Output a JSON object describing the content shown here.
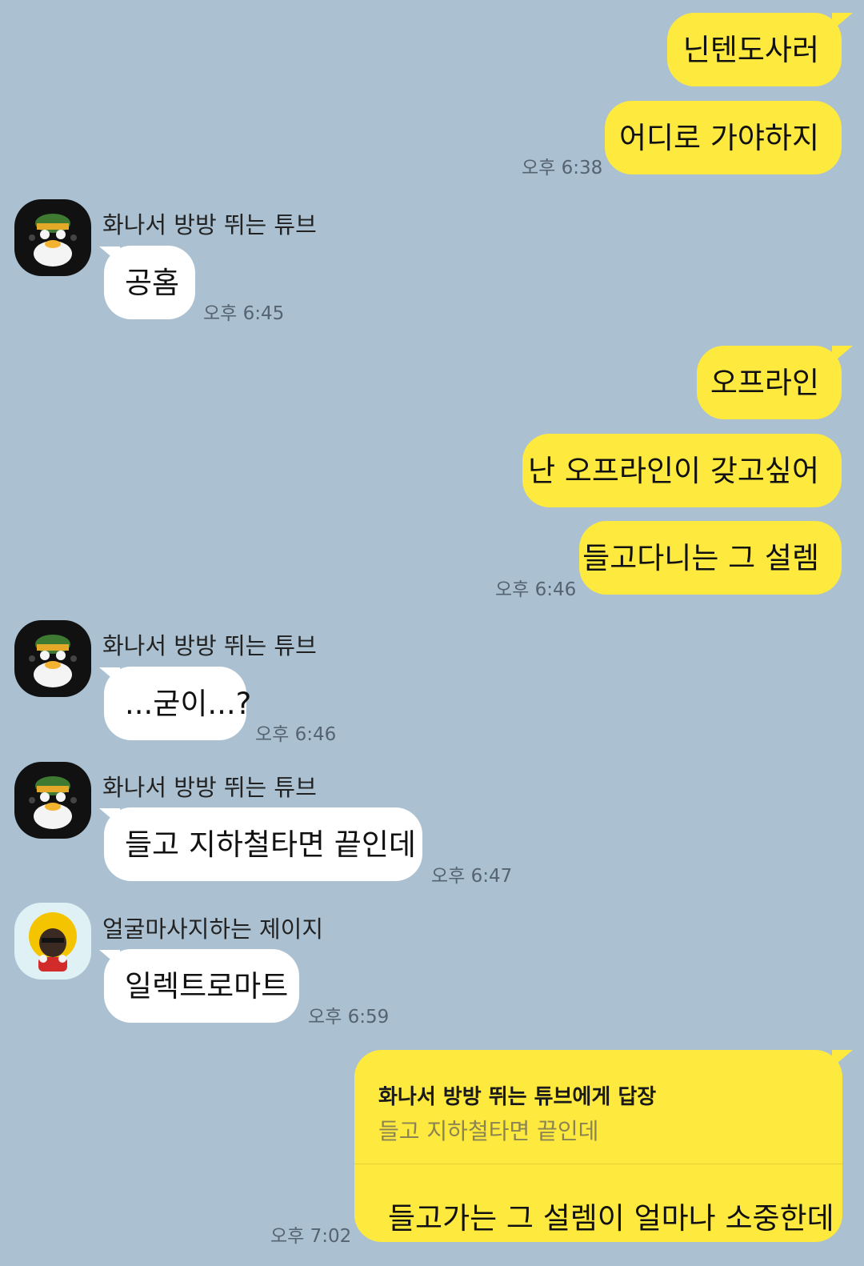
{
  "colors": {
    "background": "#abc1d1",
    "my_bubble": "#fee93e",
    "other_bubble": "#ffffff",
    "timestamp": "#556470"
  },
  "senders": {
    "tube": "화나서 방방 뛰는 튜브",
    "jay_g": "얼굴마사지하는 제이지"
  },
  "messages": {
    "m1": {
      "text": "닌텐도사러"
    },
    "m2": {
      "text": "어디로 가야하지",
      "time": "오후 6:38"
    },
    "m3": {
      "sender": "화나서 방방 뛰는 튜브",
      "text": "공홈",
      "time": "오후 6:45"
    },
    "m4": {
      "text": "오프라인"
    },
    "m5": {
      "text": "난 오프라인이 갖고싶어"
    },
    "m6": {
      "text": "들고다니는 그 설렘",
      "time": "오후 6:46"
    },
    "m7": {
      "sender": "화나서 방방 뛰는 튜브",
      "text": "...굳이...?",
      "time": "오후 6:46"
    },
    "m8": {
      "sender": "화나서 방방 뛰는 튜브",
      "text": "들고 지하철타면 끝인데",
      "time": "오후 6:47"
    },
    "m9": {
      "sender": "얼굴마사지하는 제이지",
      "text": "일렉트로마트",
      "time": "오후 6:59"
    },
    "m10": {
      "reply_to_label": "화나서 방방 뛰는 튜브에게 답장",
      "quoted": "들고 지하철타면 끝인데",
      "text": "들고가는 그 설렘이 얼마나 소중한데",
      "time": "오후 7:02"
    }
  }
}
